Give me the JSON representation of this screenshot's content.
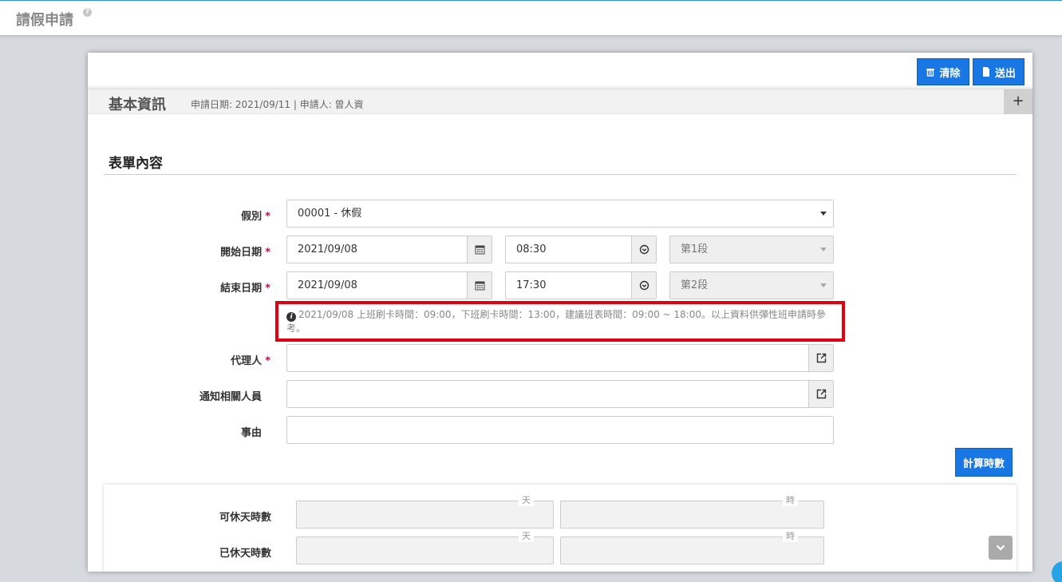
{
  "page": {
    "title": "請假申請"
  },
  "toolbar": {
    "clear_label": "清除",
    "submit_label": "送出"
  },
  "header": {
    "section_title": "基本資訊",
    "meta": "申請日期: 2021/09/11 |   申請人: 曾人資",
    "collapse_symbol": "+"
  },
  "form": {
    "title": "表單內容",
    "required_mark": "*",
    "leave_type": {
      "label": "假別",
      "value": "00001 - 休假"
    },
    "start": {
      "label": "開始日期",
      "date": "2021/09/08",
      "time": "08:30",
      "segment": "第1段"
    },
    "end": {
      "label": "結束日期",
      "date": "2021/09/08",
      "time": "17:30",
      "segment": "第2段"
    },
    "hint": "2021/09/08 上班刷卡時間：09:00，下班刷卡時間：13:00，建議班表時間：09:00 ~ 18:00。以上資料供彈性班申請時參考。",
    "agent": {
      "label": "代理人",
      "value": ""
    },
    "notify": {
      "label": "通知相關人員",
      "value": ""
    },
    "reason": {
      "label": "事由",
      "value": ""
    },
    "calc_label": "計算時數"
  },
  "stats": {
    "rows": [
      {
        "label": "可休天時數",
        "day_unit": "天",
        "hour_unit": "時"
      },
      {
        "label": "已休天時數",
        "day_unit": "天",
        "hour_unit": "時"
      }
    ]
  },
  "colors": {
    "accent": "#1877e3",
    "highlight": "#e3000f",
    "required": "#e0003c"
  }
}
